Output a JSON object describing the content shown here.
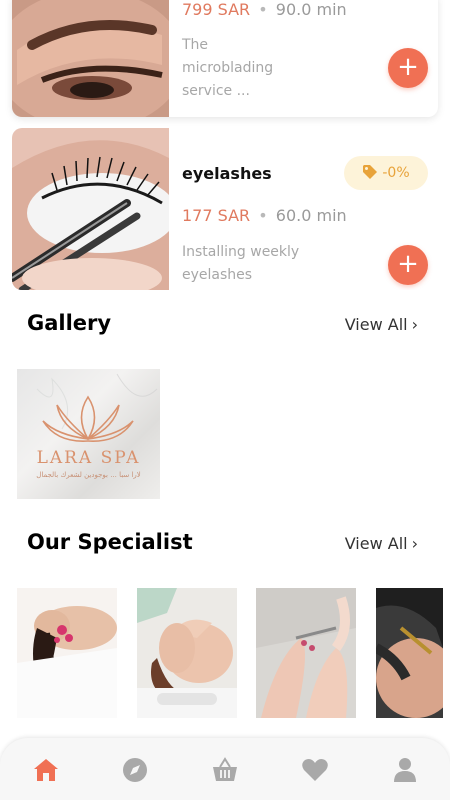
{
  "services": [
    {
      "price": "799 SAR",
      "separator": "•",
      "duration": "90.0 min",
      "description": "The microblading service ...",
      "add_label": "+"
    },
    {
      "title": "eyelashes",
      "discount": "-0%",
      "price": "177 SAR",
      "separator": "•",
      "duration": "60.0 min",
      "description": "Installing weekly eyelashes",
      "add_label": "+"
    }
  ],
  "gallery": {
    "title": "Gallery",
    "view_all": "View All",
    "items": [
      {
        "logo_text": "LARA SPA",
        "logo_sub": "لارا سبا ... بوجودين لشعرك بالجمال"
      }
    ]
  },
  "specialists": {
    "title": "Our Specialist",
    "view_all": "View All"
  },
  "bottom_nav": {
    "items": [
      {
        "icon": "home-icon",
        "active": true
      },
      {
        "icon": "compass-icon",
        "active": false
      },
      {
        "icon": "basket-icon",
        "active": false
      },
      {
        "icon": "heart-icon",
        "active": false
      },
      {
        "icon": "profile-icon",
        "active": false
      }
    ]
  },
  "colors": {
    "accent": "#f07054",
    "price": "#e07a5f",
    "badge_bg": "#fdf3d9",
    "badge_text": "#e8a33a",
    "nav_active": "#f07054",
    "nav_inactive": "#a9a9a9"
  }
}
